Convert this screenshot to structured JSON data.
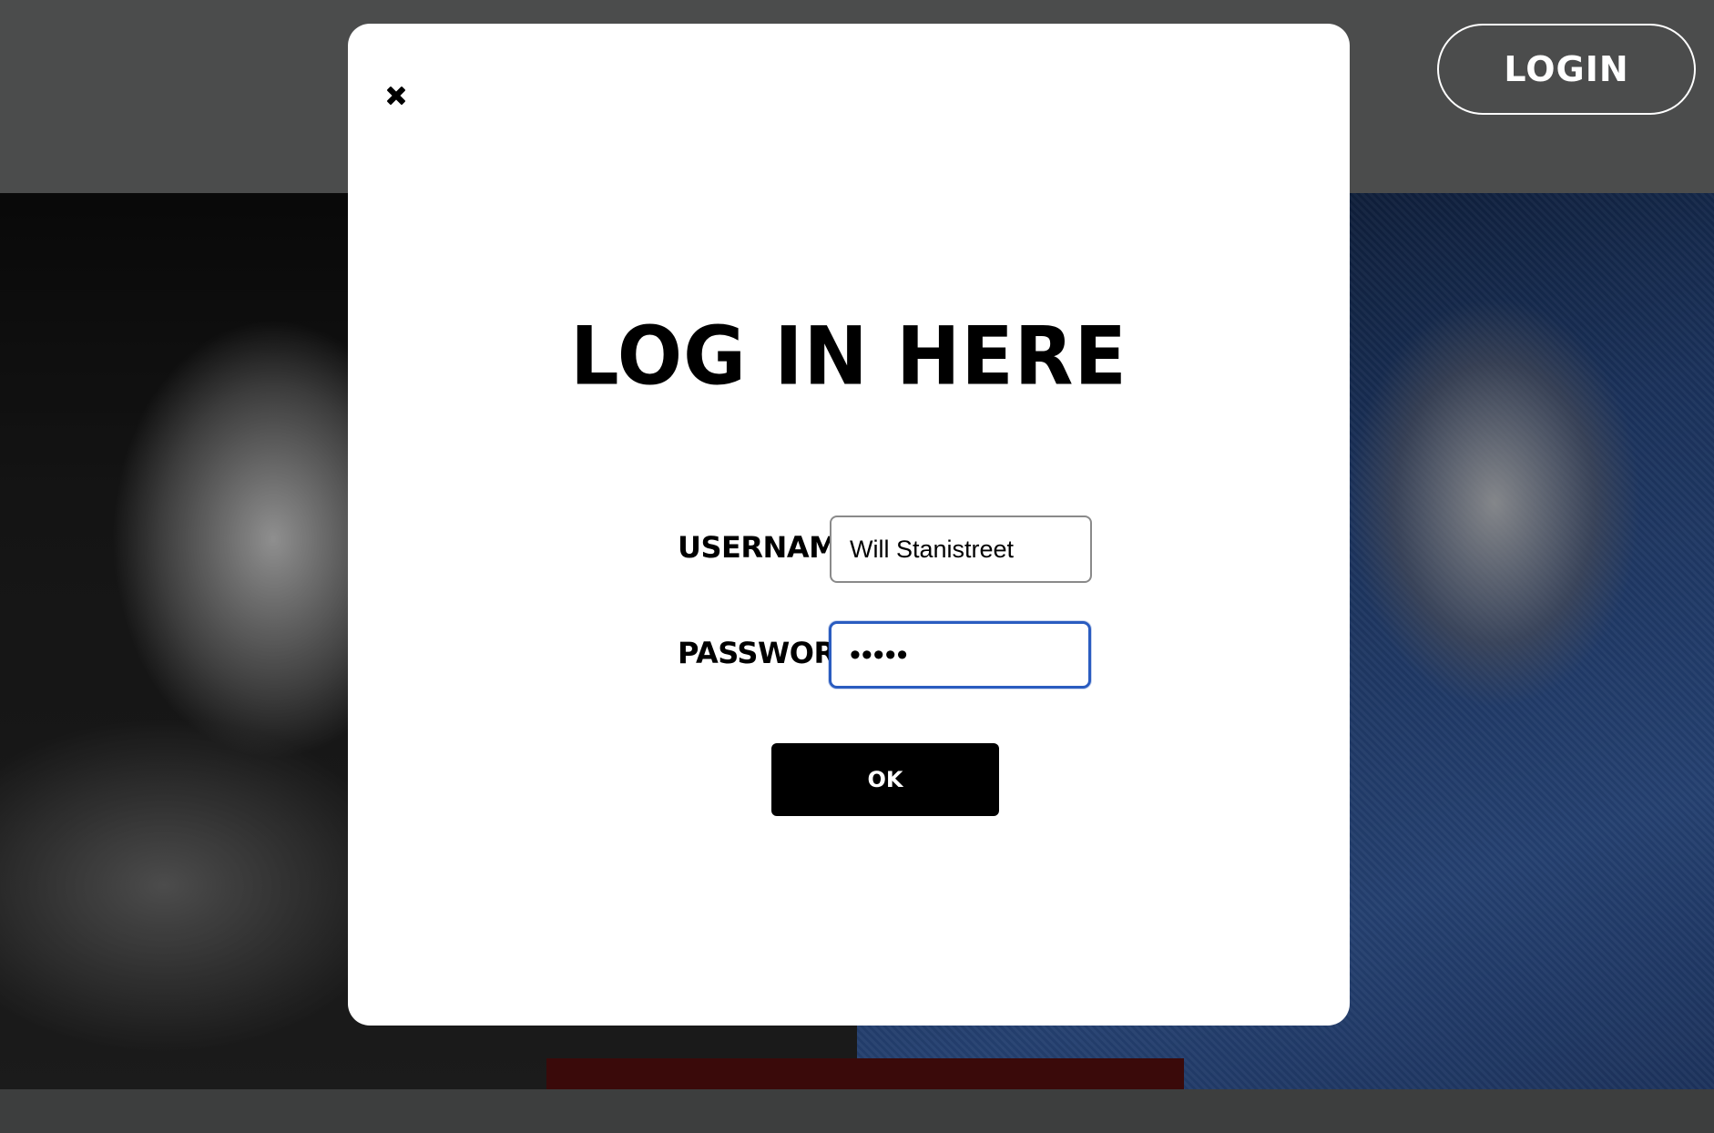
{
  "header": {
    "login_button_label": "LOGIN"
  },
  "modal": {
    "close_icon": "close-icon",
    "title": "LOG IN HERE",
    "username": {
      "label": "USERNAME:",
      "value": "Will Stanistreet"
    },
    "password": {
      "label": "PASSWORD:",
      "value": "•••••"
    },
    "submit_label": "OK"
  },
  "colors": {
    "page_background": "#3f4040",
    "modal_background": "#ffffff",
    "focus_ring": "#2a5cc0",
    "button_background": "#000000"
  }
}
